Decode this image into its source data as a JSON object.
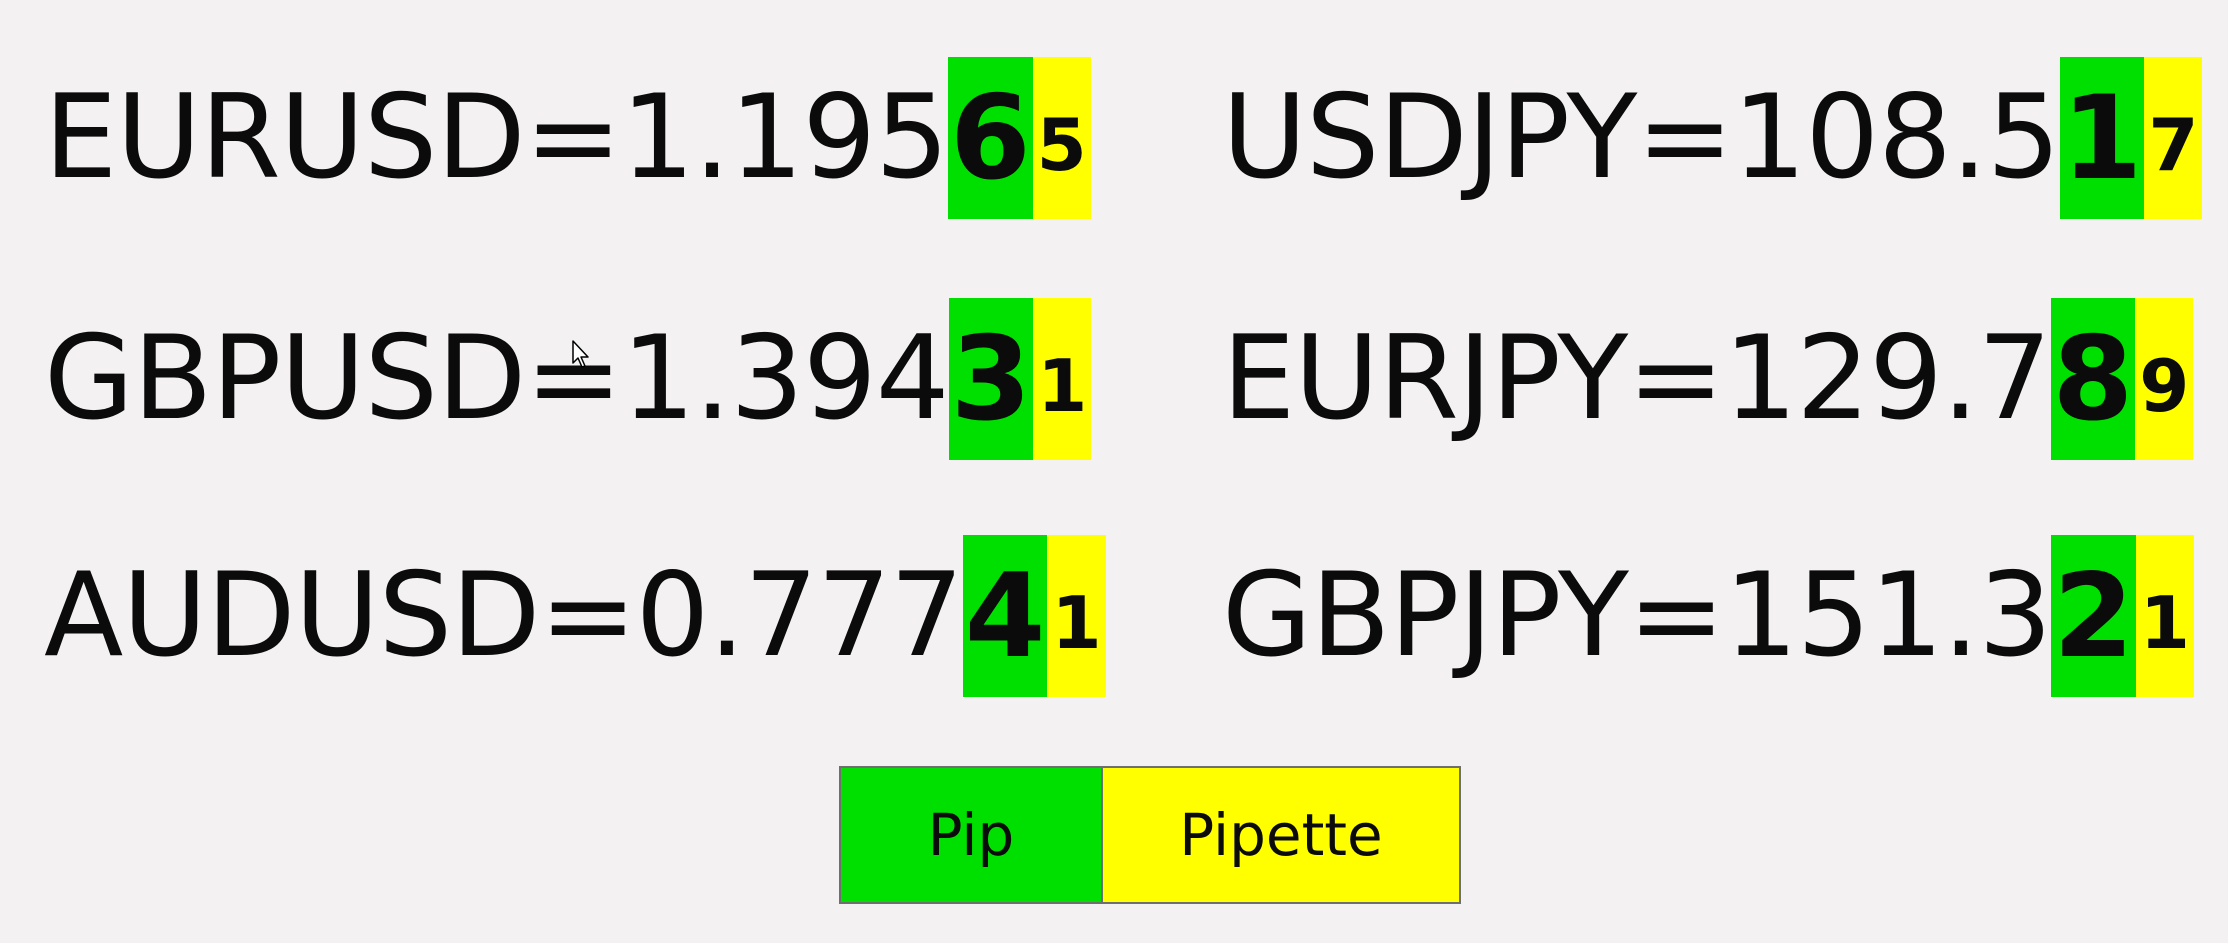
{
  "quotes": [
    {
      "label": "EURUSD=1.195",
      "pip": "6",
      "pipette": "5"
    },
    {
      "label": "GBPUSD=1.394",
      "pip": "3",
      "pipette": "1"
    },
    {
      "label": "AUDUSD=0.777",
      "pip": "4",
      "pipette": "1"
    },
    {
      "label": "USDJPY=108.5",
      "pip": "1",
      "pipette": "7"
    },
    {
      "label": "EURJPY=129.7",
      "pip": "8",
      "pipette": "9"
    },
    {
      "label": "GBPJPY=151.3",
      "pip": "2",
      "pipette": "1"
    }
  ],
  "legend": {
    "pip_label": "Pip",
    "pipette_label": "Pipette"
  },
  "colors": {
    "pip": "#00e000",
    "pipette": "#ffff00",
    "background": "#f3f1f2"
  }
}
